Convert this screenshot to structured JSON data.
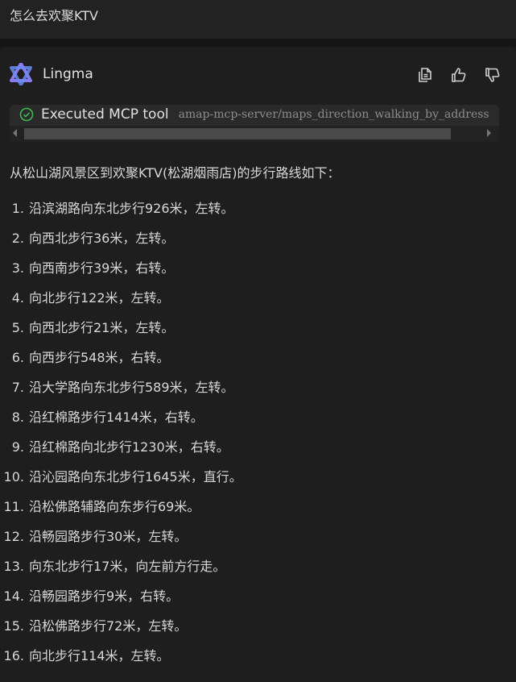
{
  "user_message": "怎么去欢聚KTV",
  "agent": {
    "name": "Lingma",
    "actions": [
      "copy",
      "thumbs-up",
      "thumbs-down"
    ]
  },
  "tool_call": {
    "status": "Executed MCP tool",
    "name": "amap-mcp-server/maps_direction_walking_by_address"
  },
  "response": {
    "intro": "从松山湖风景区到欢聚KTV(松湖烟雨店)的步行路线如下：",
    "steps": [
      {
        "num": "1.",
        "text": "沿滨湖路向东北步行926米，左转。"
      },
      {
        "num": "2.",
        "text": "向西北步行36米，左转。"
      },
      {
        "num": "3.",
        "text": "向西南步行39米，右转。"
      },
      {
        "num": "4.",
        "text": "向北步行122米，左转。"
      },
      {
        "num": "5.",
        "text": "向西北步行21米，左转。"
      },
      {
        "num": "6.",
        "text": "向西步行548米，右转。"
      },
      {
        "num": "7.",
        "text": "沿大学路向东北步行589米，左转。"
      },
      {
        "num": "8.",
        "text": "沿红棉路步行1414米，右转。"
      },
      {
        "num": "9.",
        "text": "沿红棉路向北步行1230米，右转。"
      },
      {
        "num": "10.",
        "text": "沿沁园路向东北步行1645米，直行。"
      },
      {
        "num": "11.",
        "text": "沿松佛路辅路向东步行69米。"
      },
      {
        "num": "12.",
        "text": "沿畅园路步行30米，左转。"
      },
      {
        "num": "13.",
        "text": "向东北步行17米，向左前方行走。"
      },
      {
        "num": "14.",
        "text": "沿畅园路步行9米，右转。"
      },
      {
        "num": "15.",
        "text": "沿松佛路步行72米，左转。"
      },
      {
        "num": "16.",
        "text": "向北步行114米，左转。"
      }
    ]
  },
  "colors": {
    "background": "#1a1a1a",
    "panel": "#1e1e1e",
    "accent_check": "#3fb950",
    "logo": "#8a7cf0"
  }
}
